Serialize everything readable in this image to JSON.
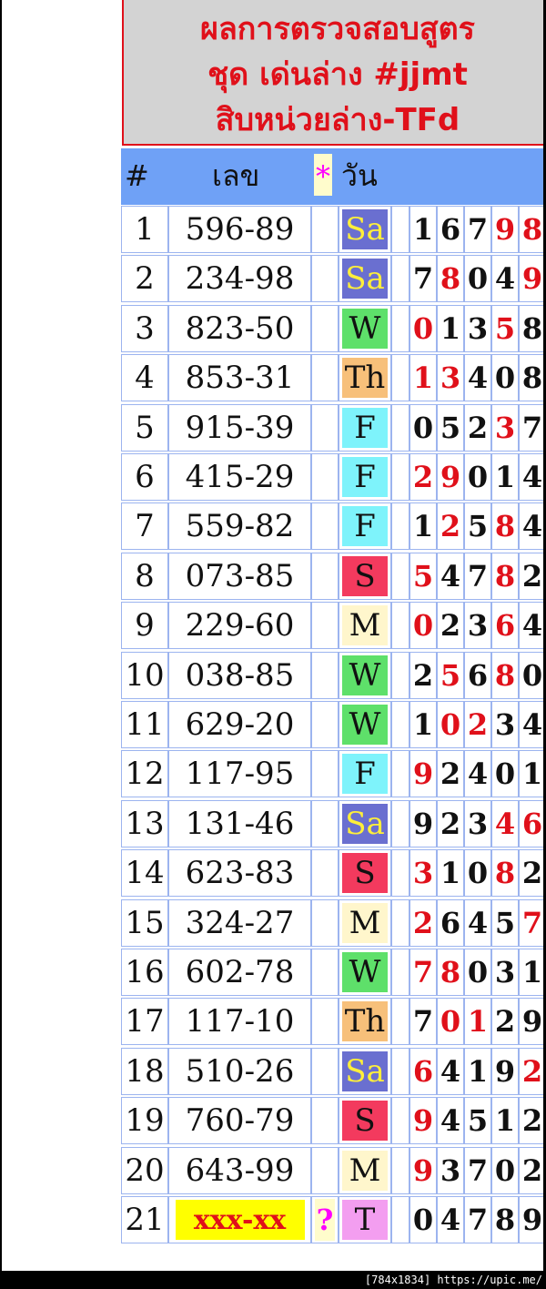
{
  "title": {
    "line1": "ผลการตรวจสอบสูตร",
    "line2": "ชุด เด่นล่าง #jjmt",
    "line3": "สิบหน่วยล่าง-TFd"
  },
  "header": {
    "num": "#",
    "lek": "เลข",
    "star": "*",
    "day": "วัน"
  },
  "colors": {
    "header_bg": "#6fa1f6",
    "title_bg": "#d3d3d3",
    "accent_red": "#e0101a",
    "magenta": "#ff00ff"
  },
  "day_colors": {
    "Sa": "#6a6fd0",
    "W": "#5ee06a",
    "Th": "#f7c07a",
    "F": "#7ef3fb",
    "S": "#f33a5e",
    "M": "#fff6cc",
    "T": "#f39ef0"
  },
  "rows": [
    {
      "n": "1",
      "lek": "596-89",
      "day": "Sa",
      "digits": [
        {
          "d": "1",
          "r": false
        },
        {
          "d": "6",
          "r": false
        },
        {
          "d": "7",
          "r": false
        },
        {
          "d": "9",
          "r": true
        },
        {
          "d": "8",
          "r": true
        }
      ]
    },
    {
      "n": "2",
      "lek": "234-98",
      "day": "Sa",
      "digits": [
        {
          "d": "7",
          "r": false
        },
        {
          "d": "8",
          "r": true
        },
        {
          "d": "0",
          "r": false
        },
        {
          "d": "4",
          "r": false
        },
        {
          "d": "9",
          "r": true
        }
      ]
    },
    {
      "n": "3",
      "lek": "823-50",
      "day": "W",
      "digits": [
        {
          "d": "0",
          "r": true
        },
        {
          "d": "1",
          "r": false
        },
        {
          "d": "3",
          "r": false
        },
        {
          "d": "5",
          "r": true
        },
        {
          "d": "8",
          "r": false
        }
      ]
    },
    {
      "n": "4",
      "lek": "853-31",
      "day": "Th",
      "digits": [
        {
          "d": "1",
          "r": true
        },
        {
          "d": "3",
          "r": true
        },
        {
          "d": "4",
          "r": false
        },
        {
          "d": "0",
          "r": false
        },
        {
          "d": "8",
          "r": false
        }
      ]
    },
    {
      "n": "5",
      "lek": "915-39",
      "day": "F",
      "digits": [
        {
          "d": "0",
          "r": false
        },
        {
          "d": "5",
          "r": false
        },
        {
          "d": "2",
          "r": false
        },
        {
          "d": "3",
          "r": true
        },
        {
          "d": "7",
          "r": false
        }
      ]
    },
    {
      "n": "6",
      "lek": "415-29",
      "day": "F",
      "digits": [
        {
          "d": "2",
          "r": true
        },
        {
          "d": "9",
          "r": true
        },
        {
          "d": "0",
          "r": false
        },
        {
          "d": "1",
          "r": false
        },
        {
          "d": "4",
          "r": false
        }
      ]
    },
    {
      "n": "7",
      "lek": "559-82",
      "day": "F",
      "digits": [
        {
          "d": "1",
          "r": false
        },
        {
          "d": "2",
          "r": true
        },
        {
          "d": "5",
          "r": false
        },
        {
          "d": "8",
          "r": true
        },
        {
          "d": "4",
          "r": false
        }
      ]
    },
    {
      "n": "8",
      "lek": "073-85",
      "day": "S",
      "digits": [
        {
          "d": "5",
          "r": true
        },
        {
          "d": "4",
          "r": false
        },
        {
          "d": "7",
          "r": false
        },
        {
          "d": "8",
          "r": true
        },
        {
          "d": "2",
          "r": false
        }
      ]
    },
    {
      "n": "9",
      "lek": "229-60",
      "day": "M",
      "digits": [
        {
          "d": "0",
          "r": true
        },
        {
          "d": "2",
          "r": false
        },
        {
          "d": "3",
          "r": false
        },
        {
          "d": "6",
          "r": true
        },
        {
          "d": "4",
          "r": false
        }
      ]
    },
    {
      "n": "10",
      "lek": "038-85",
      "day": "W",
      "digits": [
        {
          "d": "2",
          "r": false
        },
        {
          "d": "5",
          "r": true
        },
        {
          "d": "6",
          "r": false
        },
        {
          "d": "8",
          "r": true
        },
        {
          "d": "0",
          "r": false
        }
      ]
    },
    {
      "n": "11",
      "lek": "629-20",
      "day": "W",
      "digits": [
        {
          "d": "1",
          "r": false
        },
        {
          "d": "0",
          "r": true
        },
        {
          "d": "2",
          "r": true
        },
        {
          "d": "3",
          "r": false
        },
        {
          "d": "4",
          "r": false
        }
      ]
    },
    {
      "n": "12",
      "lek": "117-95",
      "day": "F",
      "digits": [
        {
          "d": "9",
          "r": true
        },
        {
          "d": "2",
          "r": false
        },
        {
          "d": "4",
          "r": false
        },
        {
          "d": "0",
          "r": false
        },
        {
          "d": "1",
          "r": false
        }
      ]
    },
    {
      "n": "13",
      "lek": "131-46",
      "day": "Sa",
      "digits": [
        {
          "d": "9",
          "r": false
        },
        {
          "d": "2",
          "r": false
        },
        {
          "d": "3",
          "r": false
        },
        {
          "d": "4",
          "r": true
        },
        {
          "d": "6",
          "r": true
        }
      ]
    },
    {
      "n": "14",
      "lek": "623-83",
      "day": "S",
      "digits": [
        {
          "d": "3",
          "r": true
        },
        {
          "d": "1",
          "r": false
        },
        {
          "d": "0",
          "r": false
        },
        {
          "d": "8",
          "r": true
        },
        {
          "d": "2",
          "r": false
        }
      ]
    },
    {
      "n": "15",
      "lek": "324-27",
      "day": "M",
      "digits": [
        {
          "d": "2",
          "r": true
        },
        {
          "d": "6",
          "r": false
        },
        {
          "d": "4",
          "r": false
        },
        {
          "d": "5",
          "r": false
        },
        {
          "d": "7",
          "r": true
        }
      ]
    },
    {
      "n": "16",
      "lek": "602-78",
      "day": "W",
      "digits": [
        {
          "d": "7",
          "r": true
        },
        {
          "d": "8",
          "r": true
        },
        {
          "d": "0",
          "r": false
        },
        {
          "d": "3",
          "r": false
        },
        {
          "d": "1",
          "r": false
        }
      ]
    },
    {
      "n": "17",
      "lek": "117-10",
      "day": "Th",
      "digits": [
        {
          "d": "7",
          "r": false
        },
        {
          "d": "0",
          "r": true
        },
        {
          "d": "1",
          "r": true
        },
        {
          "d": "2",
          "r": false
        },
        {
          "d": "9",
          "r": false
        }
      ]
    },
    {
      "n": "18",
      "lek": "510-26",
      "day": "Sa",
      "digits": [
        {
          "d": "6",
          "r": true
        },
        {
          "d": "4",
          "r": false
        },
        {
          "d": "1",
          "r": false
        },
        {
          "d": "9",
          "r": false
        },
        {
          "d": "2",
          "r": true
        }
      ]
    },
    {
      "n": "19",
      "lek": "760-79",
      "day": "S",
      "digits": [
        {
          "d": "9",
          "r": true
        },
        {
          "d": "4",
          "r": false
        },
        {
          "d": "5",
          "r": false
        },
        {
          "d": "1",
          "r": false
        },
        {
          "d": "2",
          "r": false
        }
      ]
    },
    {
      "n": "20",
      "lek": "643-99",
      "day": "M",
      "digits": [
        {
          "d": "9",
          "r": true
        },
        {
          "d": "3",
          "r": false
        },
        {
          "d": "7",
          "r": false
        },
        {
          "d": "0",
          "r": false
        },
        {
          "d": "2",
          "r": false
        }
      ]
    },
    {
      "n": "21",
      "lek": "xxx-xx",
      "day": "T",
      "ask": "?",
      "digits": [
        {
          "d": "0",
          "r": false
        },
        {
          "d": "4",
          "r": false
        },
        {
          "d": "7",
          "r": false
        },
        {
          "d": "8",
          "r": false
        },
        {
          "d": "9",
          "r": false
        }
      ]
    }
  ],
  "footer": "[784x1834] https://upic.me/"
}
